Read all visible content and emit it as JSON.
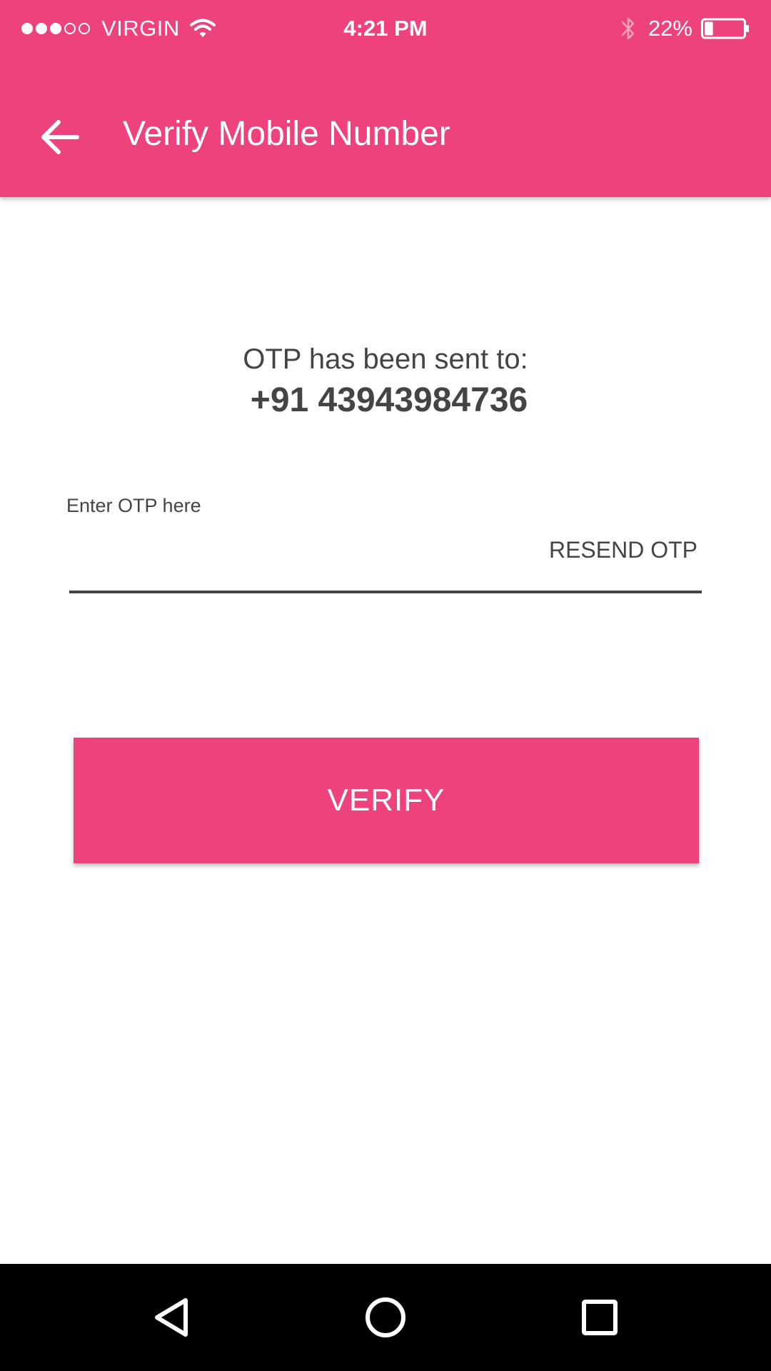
{
  "status_bar": {
    "signal": {
      "filled": 3,
      "total": 5
    },
    "carrier": "VIRGIN",
    "wifi_icon": "wifi-icon",
    "time": "4:21 PM",
    "bluetooth_icon": "bluetooth-icon",
    "battery_percent": "22%",
    "battery_level": 0.22
  },
  "toolbar": {
    "back_icon": "arrow-left-icon",
    "title": "Verify Mobile Number"
  },
  "main": {
    "otp_sent_label": "OTP has been sent to:",
    "phone_number": "+91 43943984736",
    "otp_field": {
      "label": "Enter OTP here",
      "value": "",
      "placeholder": ""
    },
    "resend_label": "RESEND OTP",
    "verify_label": "VERIFY"
  },
  "nav_bar": {
    "back_icon": "triangle-back-icon",
    "home_icon": "circle-home-icon",
    "recents_icon": "square-recents-icon"
  },
  "colors": {
    "primary": "#ED427C",
    "text": "#444444",
    "nav_background": "#000000",
    "background": "#FFFFFF"
  }
}
